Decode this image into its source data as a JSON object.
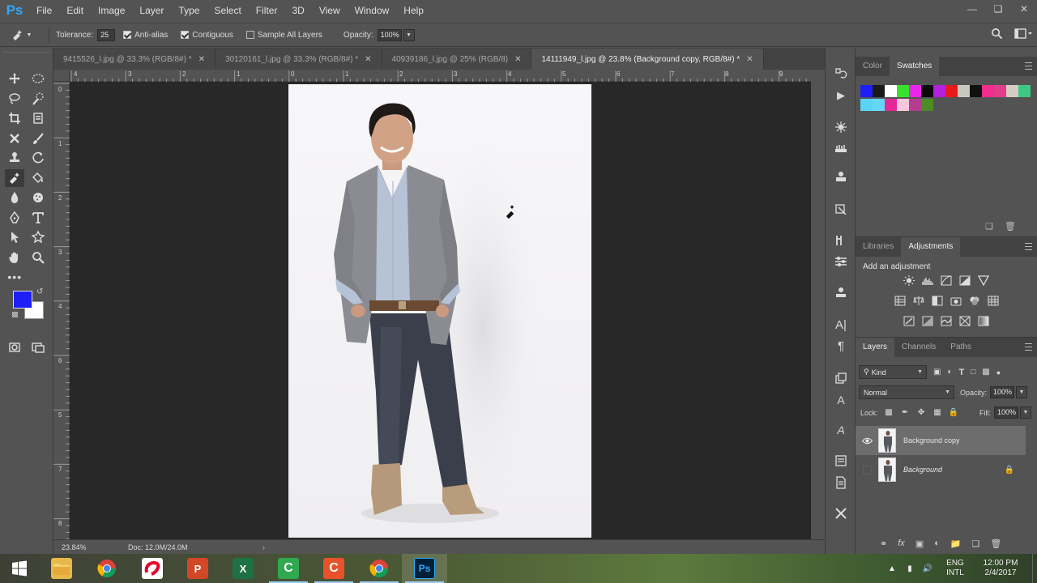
{
  "app": {
    "logo": "Ps"
  },
  "menu": [
    "File",
    "Edit",
    "Image",
    "Layer",
    "Type",
    "Select",
    "Filter",
    "3D",
    "View",
    "Window",
    "Help"
  ],
  "window_controls": [
    "minimize-icon",
    "restore-icon",
    "close-icon"
  ],
  "options": {
    "tolerance_label": "Tolerance:",
    "tolerance_value": "25",
    "anti_alias_label": "Anti-alias",
    "anti_alias_checked": true,
    "contiguous_label": "Contiguous",
    "contiguous_checked": true,
    "sample_all_label": "Sample All Layers",
    "sample_all_checked": false,
    "opacity_label": "Opacity:",
    "opacity_value": "100%"
  },
  "tabs": [
    {
      "label": "9415526_l.jpg @ 33.3% (RGB/8#) *",
      "active": false
    },
    {
      "label": "30120161_l.jpg @ 33.3% (RGB/8#) *",
      "active": false
    },
    {
      "label": "40939186_l.jpg @ 25% (RGB/8)",
      "active": false
    },
    {
      "label": "14111949_l.jpg @ 23.8% (Background copy, RGB/8#) *",
      "active": true
    }
  ],
  "ruler": {
    "top": [
      "4",
      "3",
      "2",
      "1",
      "0",
      "1",
      "2",
      "3",
      "4",
      "5",
      "6",
      "7",
      "8",
      "9"
    ],
    "left": [
      "0",
      "1",
      "2",
      "3",
      "4",
      "5",
      "6",
      "7",
      "8"
    ]
  },
  "status": {
    "zoom": "23.84%",
    "doc": "Doc: 12.0M/24.0M",
    "arrow": "›"
  },
  "colors": {
    "foreground": "#1f1ff5",
    "background": "#ffffff",
    "accent": "#31a8ff"
  },
  "swatches_panel": {
    "tabs": [
      "Color",
      "Swatches"
    ],
    "active_tab": "Swatches",
    "swatches": [
      "#1f1ff5",
      "#1a1a1a",
      "#ffffff",
      "#38e22c",
      "#e825e8",
      "#0a0a0a",
      "#b41fe0",
      "#e81919",
      "#c8c8c0",
      "#101010",
      "#f02c8c",
      "#e33c8c",
      "#d6ccc4",
      "#3cc880",
      "#5ad4f5",
      "#65d8f8",
      "#e62896",
      "#f6c7dc",
      "#b43c8c",
      "#4c8c24"
    ]
  },
  "adjustments_panel": {
    "tabs": [
      "Libraries",
      "Adjustments"
    ],
    "active_tab": "Adjustments",
    "title": "Add an adjustment"
  },
  "layers_panel": {
    "tabs": [
      "Layers",
      "Channels",
      "Paths"
    ],
    "active_tab": "Layers",
    "filter_label": "Kind",
    "blend_mode": "Normal",
    "opacity_label": "Opacity:",
    "opacity_value": "100%",
    "lock_label": "Lock:",
    "fill_label": "Fill:",
    "fill_value": "100%",
    "layers": [
      {
        "name": "Background copy",
        "visible": true,
        "selected": true,
        "locked": false
      },
      {
        "name": "Background",
        "visible": false,
        "selected": false,
        "locked": true
      }
    ]
  },
  "taskbar": {
    "apps": [
      "file-explorer-icon",
      "chrome-icon",
      "airtel-icon",
      "powerpoint-icon",
      "excel-icon",
      "camtasia-green-icon",
      "camtasia-orange-icon",
      "chrome-icon",
      "photoshop-icon"
    ],
    "lang_line1": "ENG",
    "lang_line2": "INTL",
    "time": "12:00 PM",
    "date": "2/4/2017"
  }
}
